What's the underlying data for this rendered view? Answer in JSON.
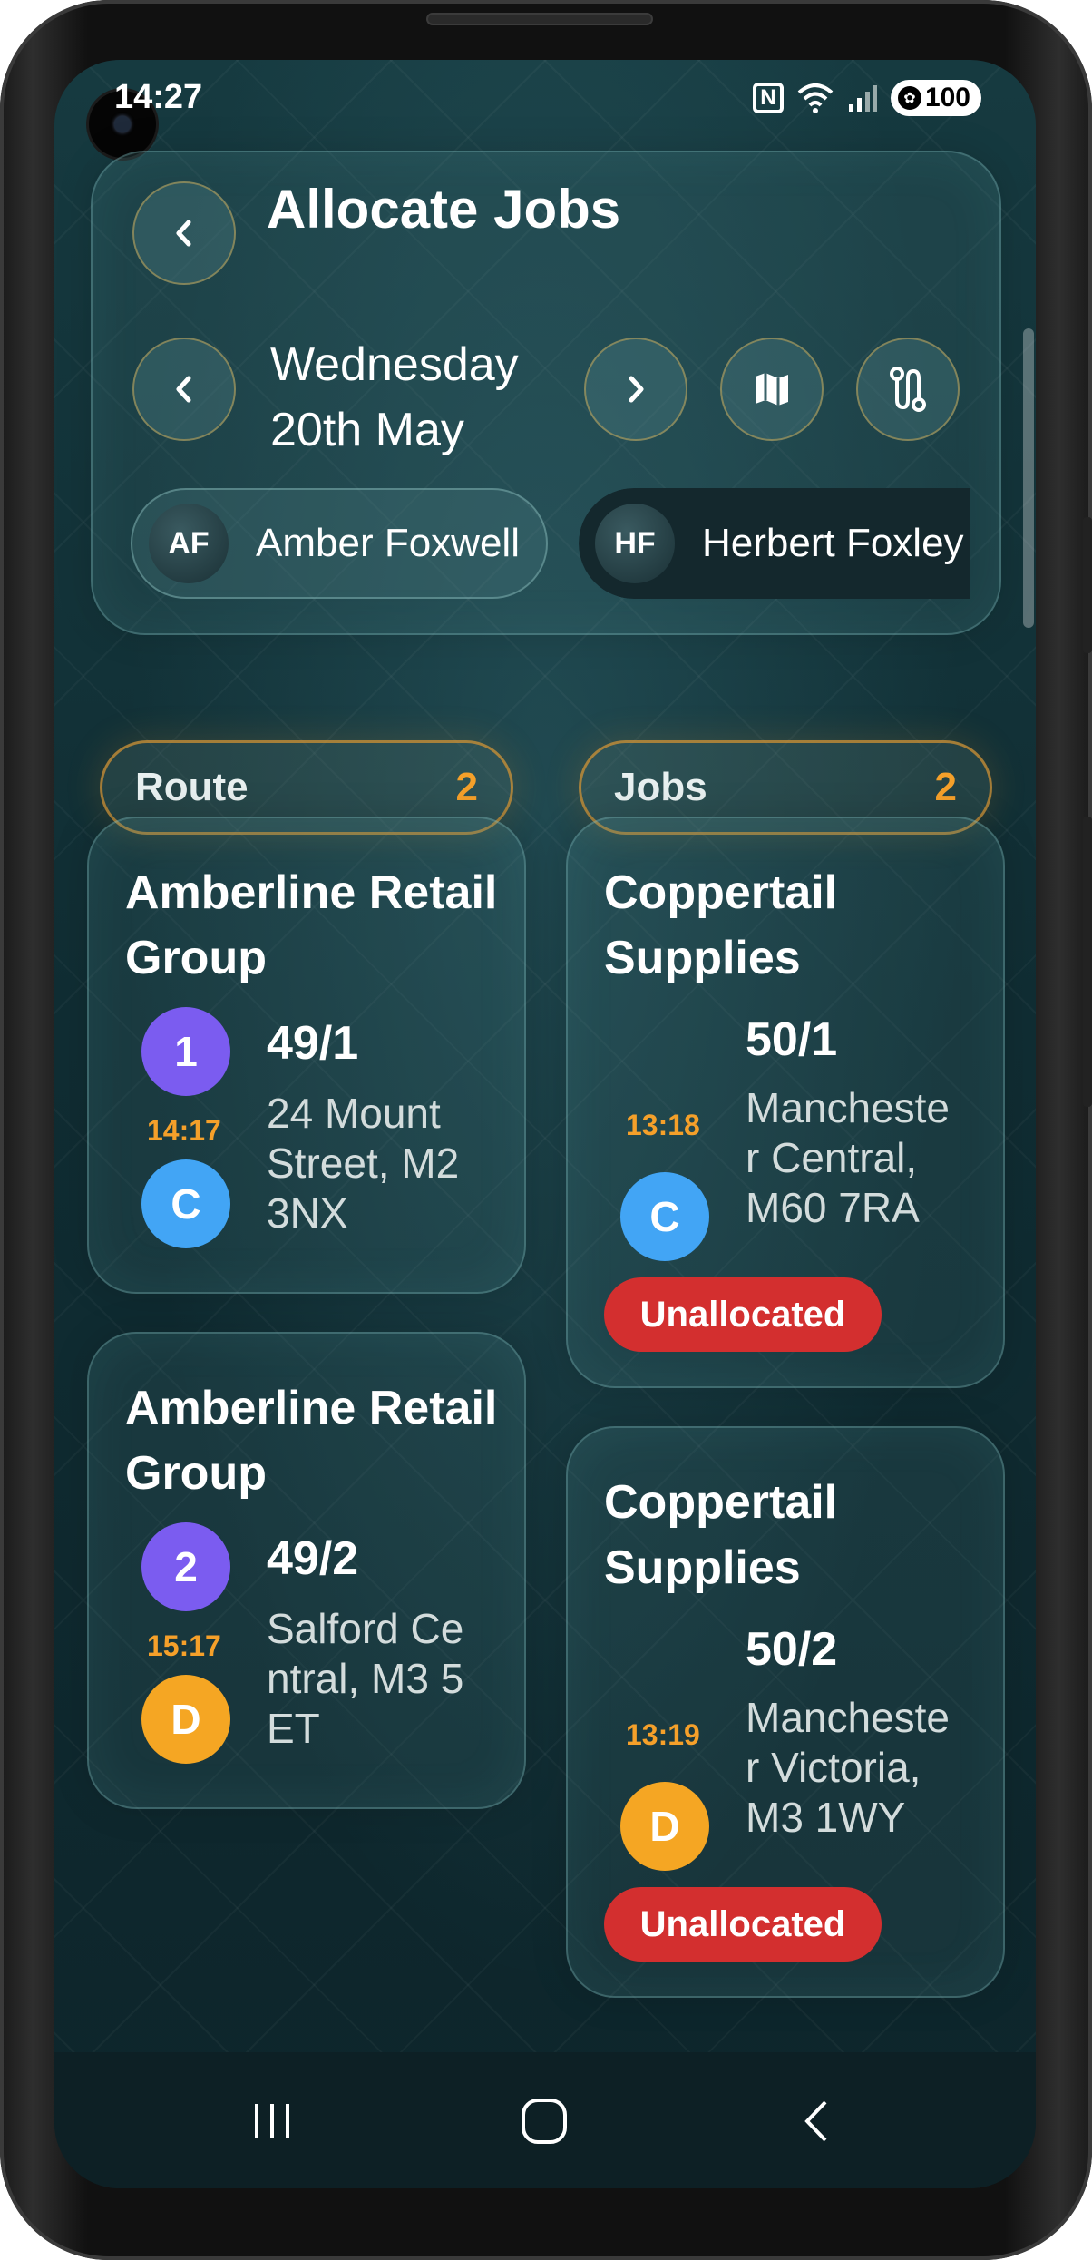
{
  "status_bar": {
    "time": "14:27",
    "battery": "100"
  },
  "header": {
    "title": "Allocate Jobs",
    "date_line1": "Wednesday",
    "date_line2": "20th May",
    "drivers": [
      {
        "initials": "AF",
        "name": "Amber Foxwell",
        "selected": false
      },
      {
        "initials": "HF",
        "name": "Herbert Foxley",
        "selected": true
      }
    ]
  },
  "tabs": {
    "route": {
      "label": "Route",
      "count": "2"
    },
    "jobs": {
      "label": "Jobs",
      "count": "2"
    }
  },
  "route_cards": [
    {
      "company": "Amberline Retail Group",
      "sequence": "1",
      "time": "14:17",
      "type": "C",
      "job_no": "49/1",
      "address": "24 Mount Street, M2 3NX"
    },
    {
      "company": "Amberline Retail Group",
      "sequence": "2",
      "time": "15:17",
      "type": "D",
      "job_no": "49/2",
      "address": "Salford Central, M3 5ET"
    }
  ],
  "job_cards": [
    {
      "company": "Coppertail Supplies",
      "time": "13:18",
      "type": "C",
      "job_no": "50/1",
      "address": "Manchester Central, M60 7RA",
      "status": "Unallocated"
    },
    {
      "company": "Coppertail Supplies",
      "time": "13:19",
      "type": "D",
      "job_no": "50/2",
      "address": "Manchester Victoria, M3 1WY",
      "status": "Unallocated"
    }
  ],
  "colors": {
    "accent": "#f5a02a",
    "sequence_badge": "#7b5cf0",
    "collection_badge": "#42a5f5",
    "delivery_badge": "#f5a623",
    "unallocated": "#d32f2f"
  },
  "icons": {
    "back": "chevron-left-icon",
    "prev_day": "chevron-left-icon",
    "next_day": "chevron-right-icon",
    "map": "map-icon",
    "route": "route-icon"
  }
}
